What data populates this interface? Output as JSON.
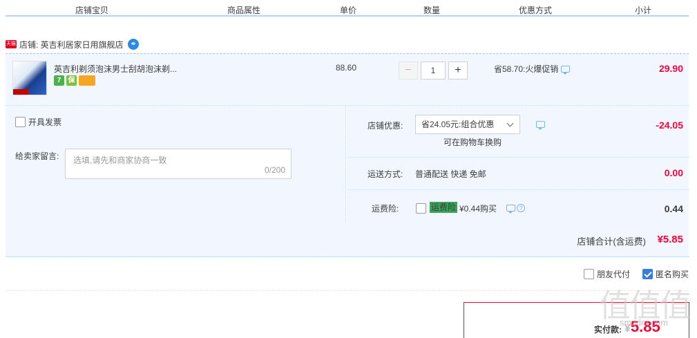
{
  "header": {
    "columns": [
      "店铺宝贝",
      "商品属性",
      "单价",
      "数量",
      "优惠方式",
      "小计"
    ]
  },
  "shop": {
    "badge": "天猫",
    "label": "店铺: 英吉利居家日用旗舰店"
  },
  "item": {
    "title": "英吉利剃须泡沫男士刮胡泡沫剃...",
    "unit_price": "88.60",
    "quantity": "1",
    "minus": "−",
    "plus": "+",
    "promo": "省58.70:火爆促销",
    "subtotal": "29.90",
    "service_icons": [
      "7",
      "保"
    ]
  },
  "options": {
    "invoice_label": "开具发票",
    "message_label": "给卖家留言:",
    "message_placeholder": "选填,请先和商家协商一致",
    "message_count": "0/200",
    "shop_discount_label": "店铺优惠:",
    "shop_discount_selected": "省24.05元:组合优惠",
    "shop_discount_note": "可在购物车换购",
    "shop_discount_amount": "-24.05",
    "shipping_label": "运送方式:",
    "shipping_value": "普通配送 快递 免邮",
    "shipping_amount": "0.00",
    "insurance_label": "运费险:",
    "insurance_tag": "运费险",
    "insurance_value": "¥0.44购买",
    "insurance_amount": "0.44"
  },
  "total": {
    "label": "店铺合计(含运费)",
    "amount": "¥5.85"
  },
  "extras": {
    "friend_pay": "朋友代付",
    "anonymous": "匿名购买",
    "anonymous_checked": true
  },
  "payment": {
    "label": "实付款:",
    "yen": "¥",
    "amount": "5.85"
  },
  "watermark": {
    "main": "值值值",
    "sub": "smzdm.com"
  },
  "colors": {
    "accent_red": "#ff0036",
    "row_bg": "#f2f7ff",
    "header_line": "#b2d1ff"
  }
}
